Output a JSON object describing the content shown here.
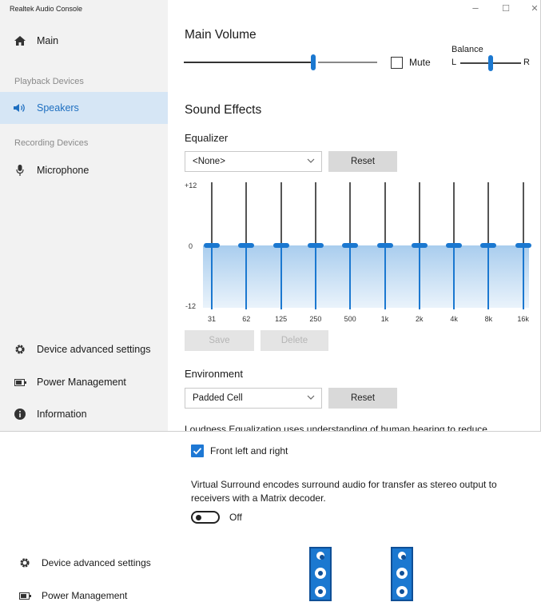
{
  "window_title": "Realtek Audio Console",
  "window_controls": {
    "minimize": "–",
    "maximize": "☐",
    "close": "✕"
  },
  "sidebar": {
    "main": "Main",
    "playback_section": "Playback Devices",
    "speakers": "Speakers",
    "recording_section": "Recording Devices",
    "microphone": "Microphone",
    "device_advanced_settings": "Device advanced settings",
    "power_management": "Power Management",
    "information": "Information"
  },
  "main_volume": {
    "title": "Main Volume",
    "level": 0.67,
    "mute_label": "Mute",
    "mute_checked": false,
    "balance_label": "Balance",
    "balance_left": "L",
    "balance_right": "R",
    "balance_level": 0.5
  },
  "sound_effects": {
    "title": "Sound Effects",
    "equalizer": {
      "label": "Equalizer",
      "preset": "<None>",
      "reset": "Reset",
      "max_label": "+12",
      "zero_label": "0",
      "min_label": "-12",
      "bands": [
        "31",
        "62",
        "125",
        "250",
        "500",
        "1k",
        "2k",
        "4k",
        "8k",
        "16k"
      ],
      "gains_db": [
        0,
        0,
        0,
        0,
        0,
        0,
        0,
        0,
        0,
        0
      ],
      "save": "Save",
      "delete": "Delete"
    },
    "environment": {
      "label": "Environment",
      "preset": "Padded Cell",
      "reset": "Reset"
    }
  },
  "lower_view": {
    "clipped_text": "Loudness Equalization uses understanding of human hearing to reduce",
    "front_left_right": "Front left and right",
    "front_left_right_checked": true,
    "virtual_surround_desc": "Virtual Surround encodes surround audio for transfer as stereo output to receivers with a Matrix decoder.",
    "toggle_label": "Off",
    "toggle_on": false,
    "sidebar": {
      "device_advanced_settings": "Device advanced settings",
      "power_management": "Power Management"
    }
  },
  "colors": {
    "accent": "#1b78d0",
    "selected_bg": "#d6e6f5",
    "sidebar_bg": "#f2f2f2"
  }
}
